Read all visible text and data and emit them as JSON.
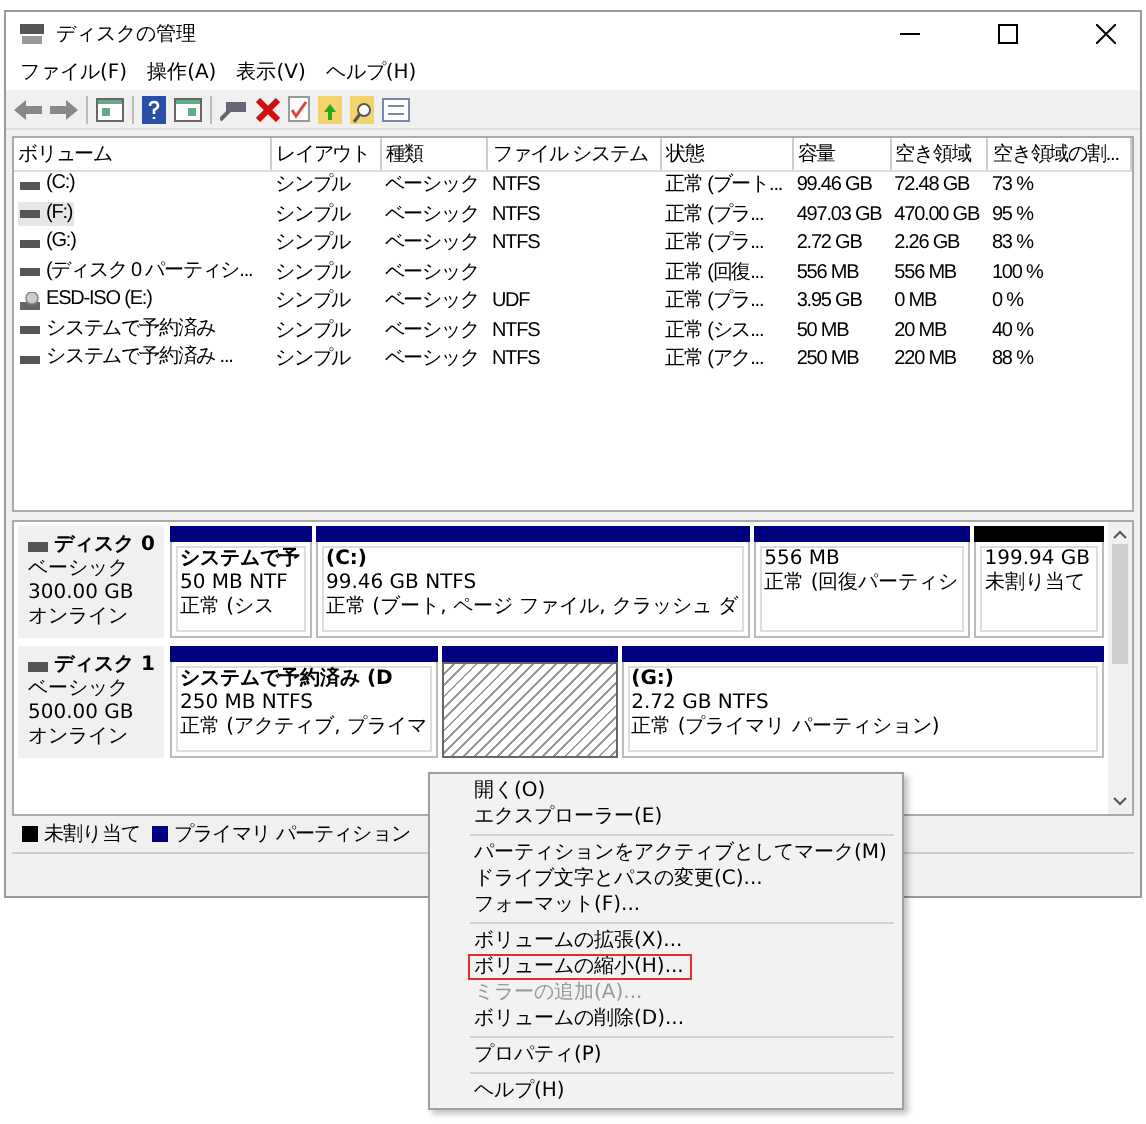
{
  "window": {
    "title": "ディスクの管理"
  },
  "menu_bar": [
    "ファイル(F)",
    "操作(A)",
    "表示(V)",
    "ヘルプ(H)"
  ],
  "volume_table": {
    "columns": [
      "ボリューム",
      "レイアウト",
      "種類",
      "ファイル システム",
      "状態",
      "容量",
      "空き領域",
      "空き領域の割..."
    ],
    "rows": [
      {
        "kind": "disk",
        "selected": false,
        "cells": [
          "(C:)",
          "シンプル",
          "ベーシック",
          "NTFS",
          "正常 (ブート...",
          "99.46 GB",
          "72.48 GB",
          "73 %"
        ]
      },
      {
        "kind": "disk",
        "selected": true,
        "cells": [
          "(F:)",
          "シンプル",
          "ベーシック",
          "NTFS",
          "正常 (プラ...",
          "497.03 GB",
          "470.00 GB",
          "95 %"
        ]
      },
      {
        "kind": "disk",
        "selected": false,
        "cells": [
          "(G:)",
          "シンプル",
          "ベーシック",
          "NTFS",
          "正常 (プラ...",
          "2.72 GB",
          "2.26 GB",
          "83 %"
        ]
      },
      {
        "kind": "disk",
        "selected": false,
        "cells": [
          "(ディスク 0 パーティシ...",
          "シンプル",
          "ベーシック",
          "",
          "正常 (回復...",
          "556 MB",
          "556 MB",
          "100 %"
        ]
      },
      {
        "kind": "cd",
        "selected": false,
        "cells": [
          "ESD-ISO (E:)",
          "シンプル",
          "ベーシック",
          "UDF",
          "正常 (プラ...",
          "3.95 GB",
          "0 MB",
          "0 %"
        ]
      },
      {
        "kind": "disk",
        "selected": false,
        "cells": [
          "システムで予約済み",
          "シンプル",
          "ベーシック",
          "NTFS",
          "正常 (シス...",
          "50 MB",
          "20 MB",
          "40 %"
        ]
      },
      {
        "kind": "disk",
        "selected": false,
        "cells": [
          "システムで予約済み ...",
          "シンプル",
          "ベーシック",
          "NTFS",
          "正常 (アク...",
          "250 MB",
          "220 MB",
          "88 %"
        ]
      }
    ]
  },
  "disks": [
    {
      "name": "ディスク 0",
      "type": "ベーシック",
      "size": "300.00 GB",
      "status": "オンライン",
      "partitions": [
        {
          "kind": "primary",
          "selected": false,
          "name": "システムで予",
          "size": "50 MB NTF",
          "status": "正常 (シス"
        },
        {
          "kind": "primary",
          "selected": false,
          "name": "(C:)",
          "size": "99.46 GB NTFS",
          "status": "正常 (ブート, ページ ファイル, クラッシュ ダ"
        },
        {
          "kind": "primary",
          "selected": false,
          "size": "556 MB",
          "status": "正常 (回復パーティシ"
        },
        {
          "kind": "unallocated",
          "selected": false,
          "size": "199.94 GB",
          "status": "未割り当て"
        }
      ]
    },
    {
      "name": "ディスク 1",
      "type": "ベーシック",
      "size": "500.00 GB",
      "status": "オンライン",
      "partitions": [
        {
          "kind": "primary",
          "selected": false,
          "name": "システムで予約済み (D",
          "size": "250 MB NTFS",
          "status": "正常 (アクティブ, プライマ"
        },
        {
          "kind": "primary",
          "selected": true
        },
        {
          "kind": "primary",
          "selected": false,
          "name": "(G:)",
          "size": "2.72 GB NTFS",
          "status": "正常 (プライマリ パーティション)"
        }
      ]
    }
  ],
  "legend": [
    {
      "label": "未割り当て",
      "color": "#000000"
    },
    {
      "label": "プライマリ パーティション",
      "color": "#000080"
    }
  ],
  "context_menu": {
    "items": [
      {
        "kind": "item",
        "label": "開く(O)",
        "disabled": false,
        "highlighted": false
      },
      {
        "kind": "item",
        "label": "エクスプローラー(E)",
        "disabled": false,
        "highlighted": false
      },
      {
        "kind": "separator"
      },
      {
        "kind": "item",
        "label": "パーティションをアクティブとしてマーク(M)",
        "disabled": false,
        "highlighted": false
      },
      {
        "kind": "item",
        "label": "ドライブ文字とパスの変更(C)...",
        "disabled": false,
        "highlighted": false
      },
      {
        "kind": "item",
        "label": "フォーマット(F)...",
        "disabled": false,
        "highlighted": false
      },
      {
        "kind": "separator"
      },
      {
        "kind": "item",
        "label": "ボリュームの拡張(X)...",
        "disabled": false,
        "highlighted": false
      },
      {
        "kind": "item",
        "label": "ボリュームの縮小(H)...",
        "disabled": false,
        "highlighted": true
      },
      {
        "kind": "item",
        "label": "ミラーの追加(A)...",
        "disabled": true,
        "highlighted": false
      },
      {
        "kind": "item",
        "label": "ボリュームの削除(D)...",
        "disabled": false,
        "highlighted": false
      },
      {
        "kind": "separator"
      },
      {
        "kind": "item",
        "label": "プロパティ(P)",
        "disabled": false,
        "highlighted": false
      },
      {
        "kind": "separator"
      },
      {
        "kind": "item",
        "label": "ヘルプ(H)",
        "disabled": false,
        "highlighted": false
      }
    ]
  }
}
